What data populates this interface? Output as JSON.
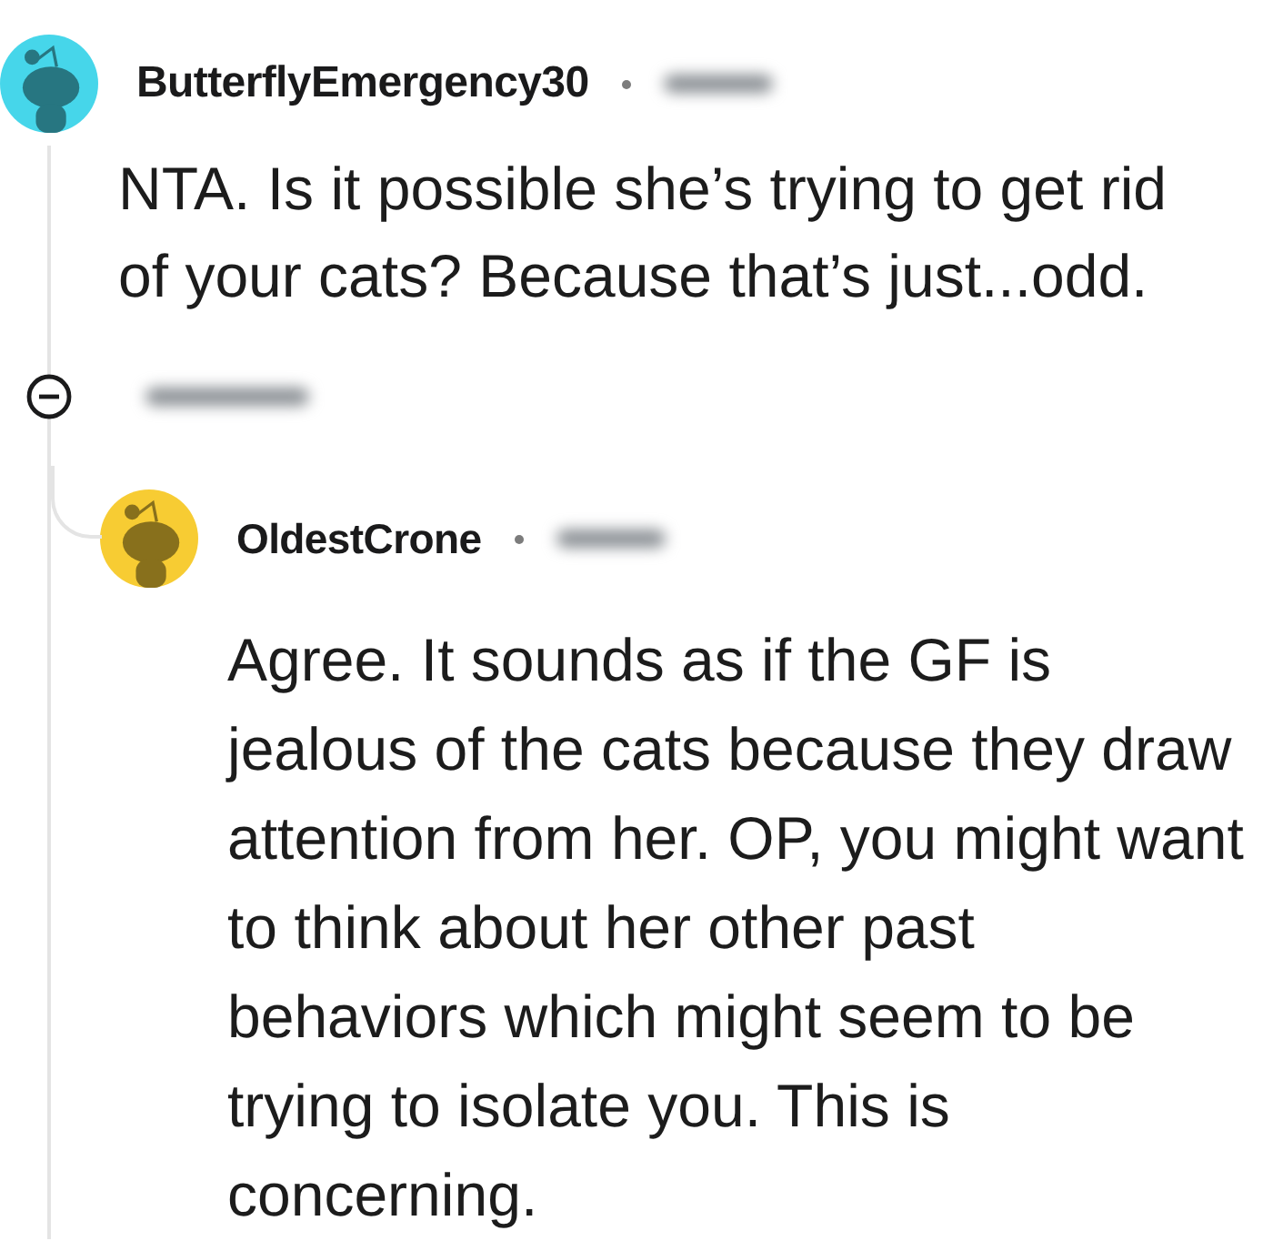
{
  "comments": [
    {
      "username": "ButterflyEmergency30",
      "color": "#46d6ea",
      "body": "NTA. Is it possible she’s trying to get rid of your cats? Because that’s just...odd.",
      "children": [
        {
          "username": "OldestCrone",
          "color": "#f7cc33",
          "body": "Agree. It sounds as if the GF is jealous of the cats because they draw attention from her. OP, you might want to think about her other past behaviors which might seem to be trying to isolate you. This is concerning."
        }
      ]
    }
  ]
}
